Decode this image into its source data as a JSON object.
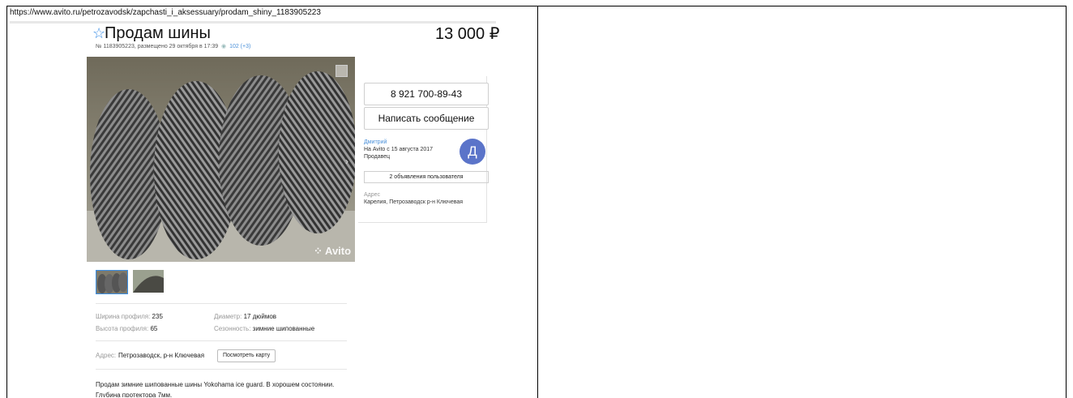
{
  "url": "https://www.avito.ru/petrozavodsk/zapchasti_i_aksessuary/prodam_shiny_1183905223",
  "ad": {
    "title": "Продам шины",
    "price": "13 000 ₽",
    "meta_prefix": "№ 1183905223, размещено 29 октября в 17:39",
    "views": "102 (+3)"
  },
  "photo": {
    "watermark": "Avito"
  },
  "sidebar": {
    "phone": "8 921 700-89-43",
    "message_button": "Написать сообщение",
    "seller_name": "Дмитрий",
    "seller_since": "На Avito с 15 августа 2017",
    "seller_role": "Продавец",
    "avatar_letter": "Д",
    "ads_button": "2 объявления пользователя",
    "address_label": "Адрес",
    "address": "Карелия, Петрозаводск р-н Ключевая"
  },
  "props": [
    {
      "key": "Ширина профиля:",
      "value": "235"
    },
    {
      "key": "Диаметр:",
      "value": "17 дюймов"
    },
    {
      "key": "Высота профиля:",
      "value": "65"
    },
    {
      "key": "Сезонность:",
      "value": "зимние шипованные"
    }
  ],
  "address": {
    "label": "Адрес:",
    "value": "Петрозаводск, р-н Ключевая",
    "map_button": "Посмотреть карту"
  },
  "description": {
    "line1": "Продам зимние шипованные шины Yokohama ice guard. В хорошем состоянии.",
    "line2": "Глубина протектора 7мм."
  },
  "colors": {
    "accent": "#3a8ee6",
    "avatar": "#5b74c9"
  }
}
